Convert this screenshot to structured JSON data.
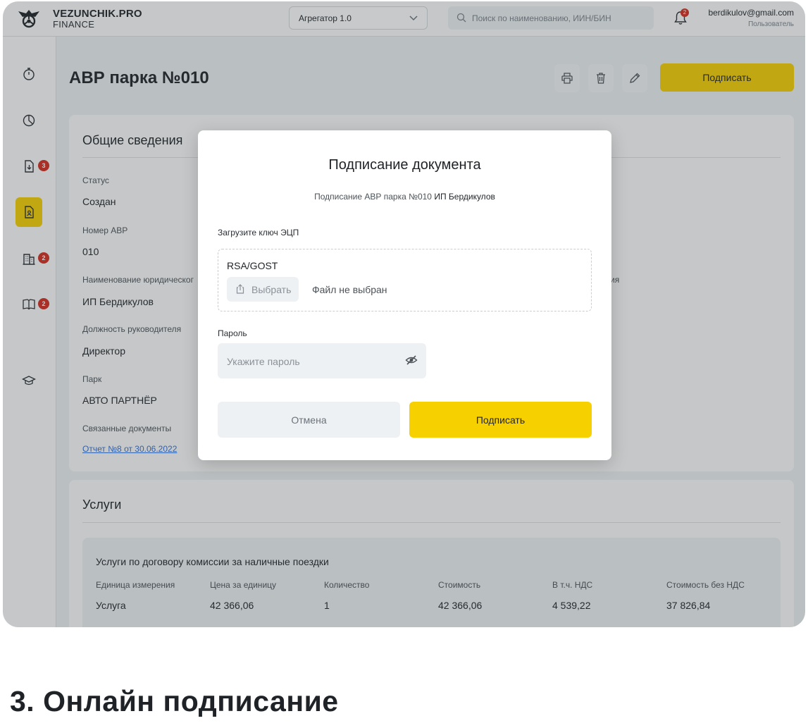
{
  "header": {
    "brand": "VEZUNCHIK.PRO",
    "brand_sub": "FINANCE",
    "aggregator": "Агрегатор 1.0",
    "search_placeholder": "Поиск по наименованию, ИИН/БИН",
    "notifications_count": "2",
    "user_email": "berdikulov@gmail.com",
    "user_role": "Пользователь"
  },
  "sidebar": {
    "items": [
      {
        "icon": "stopwatch-icon",
        "badge": ""
      },
      {
        "icon": "pie-chart-icon",
        "badge": ""
      },
      {
        "icon": "document-download-icon",
        "badge": "3"
      },
      {
        "icon": "document-user-icon",
        "badge": "",
        "active": true
      },
      {
        "icon": "buildings-icon",
        "badge": "2"
      },
      {
        "icon": "book-icon",
        "badge": "2"
      },
      {
        "icon": "graduation-cap-icon",
        "badge": ""
      }
    ]
  },
  "page": {
    "title": "АВР парка №010",
    "sign_label": "Подписать"
  },
  "general": {
    "title": "Общие сведения",
    "fields": [
      {
        "label": "Статус",
        "value": "Создан"
      },
      {
        "label": "Номер АВР",
        "value": "010"
      },
      {
        "label": "Наименование юридическог",
        "value": "ИП Бердикулов"
      },
      {
        "label": "Должность руководителя",
        "value": "Директор"
      },
      {
        "label": "Парк",
        "value": "АВТО ПАРТНЁР"
      }
    ],
    "linked_label": "Связанные документы",
    "linked_doc": "Отчет №8 от 30.06.2022",
    "right_fragment": "ия"
  },
  "services": {
    "title": "Услуги",
    "box_title": "Услуги по договору комиссии за наличные поездки",
    "columns": [
      "Единица измерения",
      "Цена за единицу",
      "Количество",
      "Стоимость",
      "В т.ч. НДС",
      "Стоимость без НДС"
    ],
    "row": [
      "Услуга",
      "42 366,06",
      "1",
      "42 366,06",
      "4 539,22",
      "37 826,84"
    ]
  },
  "modal": {
    "title": "Подписание документа",
    "subtitle_prefix": "Подписание АВР парка №010",
    "subtitle_org": "ИП Бердикулов",
    "key_label": "Загрузите ключ ЭЦП",
    "key_type": "RSA/GOST",
    "choose_label": "Выбрать",
    "no_file": "Файл не выбран",
    "password_label": "Пароль",
    "password_placeholder": "Укажите пароль",
    "cancel_label": "Отмена",
    "sign_label": "Подписать"
  },
  "caption": "3. Онлайн подписание"
}
